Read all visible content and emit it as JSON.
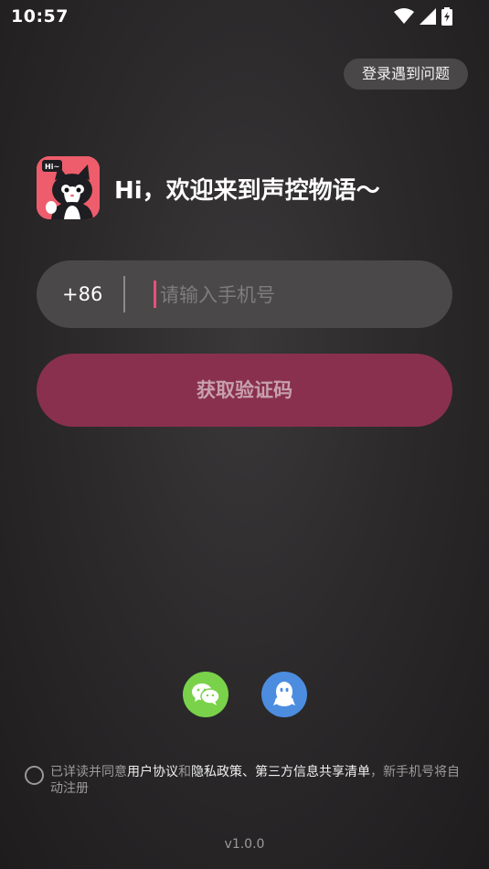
{
  "status_bar": {
    "time": "10:57"
  },
  "header": {
    "help_label": "登录遇到问题"
  },
  "welcome": {
    "title": "Hi，欢迎来到声控物语～",
    "avatar_badge": "Hi~"
  },
  "phone": {
    "country_code": "+86",
    "placeholder": "请输入手机号",
    "value": ""
  },
  "code_button_label": "获取验证码",
  "social_login": {
    "wechat_icon": "wechat-icon",
    "qq_icon": "qq-icon"
  },
  "agreement": {
    "prefix": "已详读并同意",
    "user_agreement": "用户协议",
    "and": "和",
    "privacy_policy": "隐私政策",
    "separator": "、",
    "third_party": "第三方信息共享清单",
    "suffix": "，新手机号将自动注册"
  },
  "version": "v1.0.0",
  "colors": {
    "accent": "#89304f",
    "cursor": "#e8507a",
    "wechat": "#7ad24a",
    "qq": "#4c8de0"
  }
}
